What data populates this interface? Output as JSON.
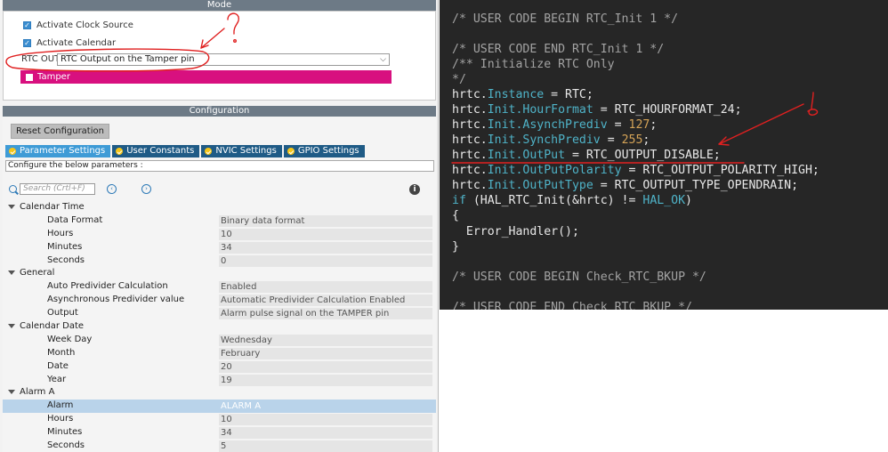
{
  "mode": {
    "header": "Mode",
    "activate_clock_source": "Activate Clock Source",
    "activate_calendar": "Activate Calendar",
    "rtc_out_label": "RTC OUT",
    "rtc_out_value": "RTC Output on the Tamper pin",
    "tamper_label": "Tamper"
  },
  "config": {
    "header": "Configuration",
    "reset_button": "Reset Configuration",
    "tabs": [
      "Parameter Settings",
      "User Constants",
      "NVIC Settings",
      "GPIO Settings"
    ],
    "description": "Configure the below parameters :",
    "search_placeholder": "Search (Crtl+F)",
    "info_glyph": "i",
    "nav_left": "‹",
    "nav_right": "›"
  },
  "parameters": [
    {
      "group": "Calendar Time",
      "items": [
        {
          "label": "Data Format",
          "value": "Binary data format"
        },
        {
          "label": "Hours",
          "value": "10"
        },
        {
          "label": "Minutes",
          "value": "34"
        },
        {
          "label": "Seconds",
          "value": "0"
        }
      ]
    },
    {
      "group": "General",
      "items": [
        {
          "label": "Auto Predivider Calculation",
          "value": "Enabled"
        },
        {
          "label": "Asynchronous Predivider value",
          "value": "Automatic Predivider Calculation Enabled"
        },
        {
          "label": "Output",
          "value": "Alarm pulse signal on the TAMPER pin"
        }
      ]
    },
    {
      "group": "Calendar Date",
      "items": [
        {
          "label": "Week Day",
          "value": "Wednesday"
        },
        {
          "label": "Month",
          "value": "February"
        },
        {
          "label": "Date",
          "value": "20"
        },
        {
          "label": "Year",
          "value": "19"
        }
      ]
    },
    {
      "group": "Alarm A",
      "items": [
        {
          "label": "Alarm",
          "value": "ALARM A",
          "selected": true
        },
        {
          "label": "Hours",
          "value": "10"
        },
        {
          "label": "Minutes",
          "value": "34"
        },
        {
          "label": "Seconds",
          "value": "5"
        }
      ]
    }
  ],
  "code": {
    "l1": "/* USER CODE BEGIN RTC_Init 1 */",
    "l2": "/* USER CODE END RTC_Init 1 */",
    "l3": "/** Initialize RTC Only",
    "l4": "*/",
    "instance": {
      "obj": "hrtc.",
      "field": "Instance",
      "rest": " = RTC;"
    },
    "hourformat": {
      "obj": "hrtc.",
      "field": "Init.HourFormat",
      "rest": " = RTC_HOURFORMAT_24;"
    },
    "asynch": {
      "obj": "hrtc.",
      "field": "Init.AsynchPrediv",
      "eq": " = ",
      "num": "127",
      "end": ";"
    },
    "synch": {
      "obj": "hrtc.",
      "field": "Init.SynchPrediv",
      "eq": " = ",
      "num": "255",
      "end": ";"
    },
    "output": {
      "obj": "hrtc.",
      "field": "Init.OutPut",
      "rest": " = RTC_OUTPUT_DISABLE;"
    },
    "polarity": {
      "obj": "hrtc.",
      "field": "Init.OutPutPolarity",
      "rest": " = RTC_OUTPUT_POLARITY_HIGH;"
    },
    "type": {
      "obj": "hrtc.",
      "field": "Init.OutPutType",
      "rest": " = RTC_OUTPUT_TYPE_OPENDRAIN;"
    },
    "if": {
      "kw": "if",
      "mid": " (HAL_RTC_Init(&hrtc) != ",
      "ok": "HAL_OK",
      "end": ")"
    },
    "open": "{",
    "err": "  Error_Handler();",
    "close": "}",
    "l_begin_bkup": "/* USER CODE BEGIN Check_RTC_BKUP */",
    "l_end_bkup": "/* USER CODE END Check_RTC_BKUP */"
  },
  "colors": {
    "annotation": "#e02020",
    "tamper": "#d8107f",
    "code_bg": "#262626"
  }
}
